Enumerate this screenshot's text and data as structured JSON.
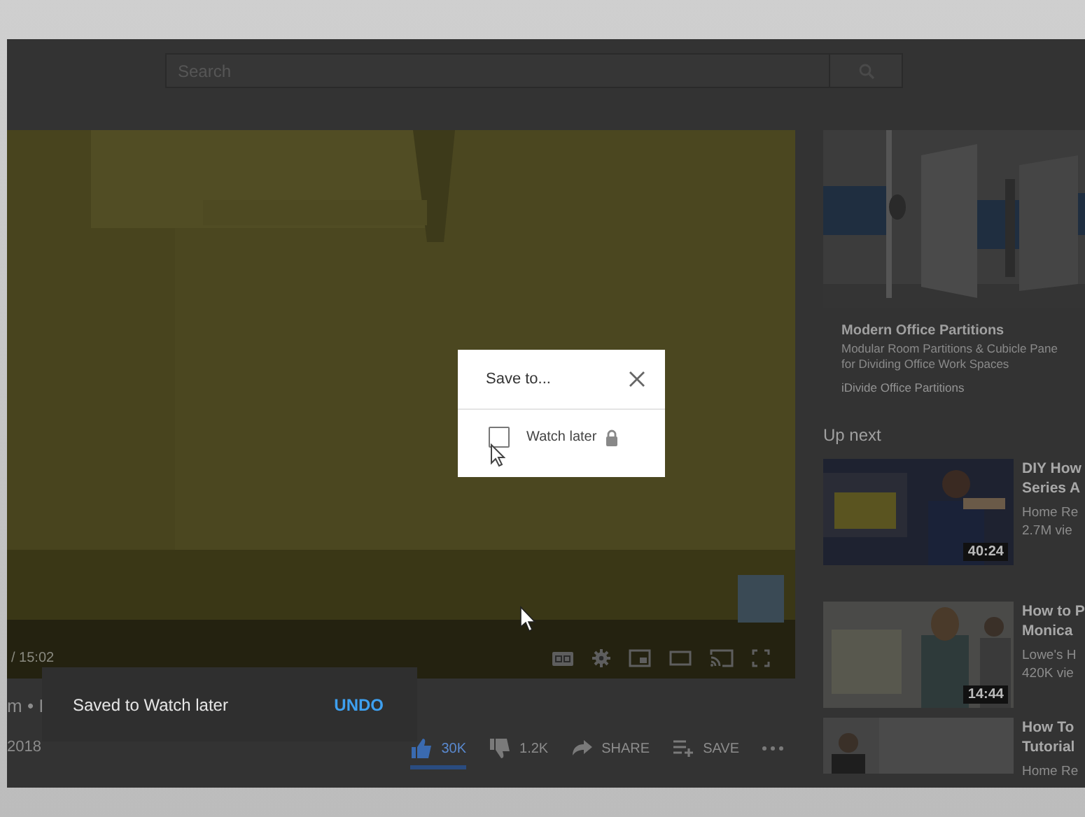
{
  "search": {
    "placeholder": "Search"
  },
  "player": {
    "time": "/ 15:02",
    "controls": [
      {
        "kind": "cc"
      },
      {
        "kind": "settings"
      },
      {
        "kind": "miniplayer"
      },
      {
        "kind": "theater"
      },
      {
        "kind": "cast"
      },
      {
        "kind": "fullscreen"
      }
    ]
  },
  "dialog": {
    "title": "Save to...",
    "playlists": [
      {
        "name": "Watch later",
        "checked": false,
        "private": true
      }
    ]
  },
  "video": {
    "title": "m • I",
    "date": "2018",
    "actions": [
      {
        "kind": "like",
        "label": "30K",
        "selected": true
      },
      {
        "kind": "dislike",
        "label": "1.2K",
        "selected": false
      },
      {
        "kind": "share",
        "label": "SHARE"
      },
      {
        "kind": "save",
        "label": "SAVE"
      },
      {
        "kind": "more"
      }
    ]
  },
  "snackbar": {
    "message": "Saved to Watch later",
    "action": "UNDO"
  },
  "ad": {
    "title": "Modern Office Partitions",
    "description": [
      "Modular Room Partitions & Cubicle Pane",
      "for Dividing Office Work Spaces"
    ],
    "advertiser": "iDivide Office Partitions"
  },
  "up_next": {
    "heading": "Up next",
    "videos": [
      {
        "title": [
          "DIY How",
          "Series A"
        ],
        "channel": "Home Re",
        "views": "2.7M vie",
        "duration": "40:24"
      },
      {
        "title": [
          "How to P",
          "Monica"
        ],
        "channel": "Lowe's H",
        "views": "420K vie",
        "duration": "14:44"
      },
      {
        "title": [
          "How To",
          "Tutorial"
        ],
        "channel": "Home Re"
      }
    ]
  }
}
